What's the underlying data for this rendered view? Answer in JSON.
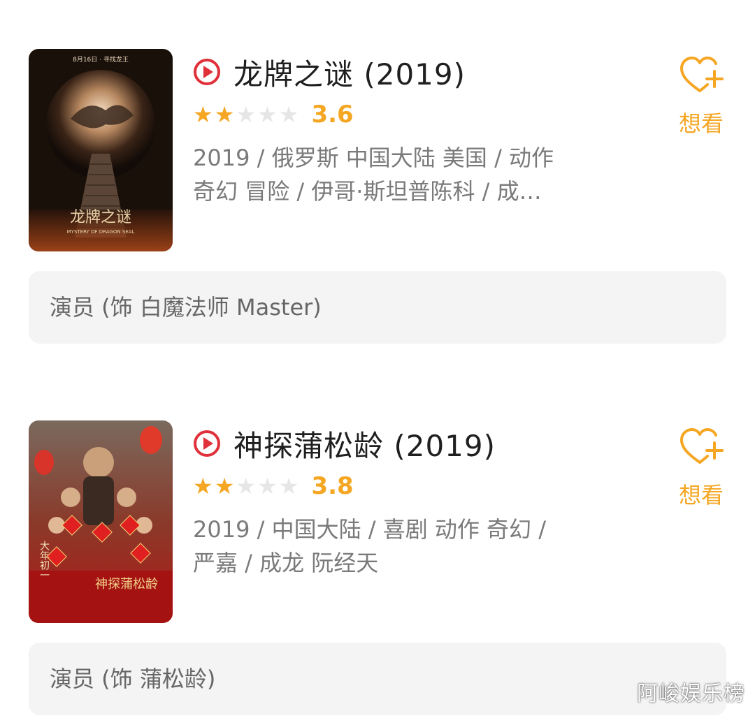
{
  "movies": [
    {
      "title": "龙牌之谜 (2019)",
      "stars_filled": 2,
      "stars_total": 5,
      "score": "3.6",
      "meta_line1": "2019 / 俄罗斯 中国大陆 美国 / 动作",
      "meta_line2": "奇幻 冒险 / 伊哥·斯坦普陈科 / 成…",
      "want_label": "想看",
      "role": "演员 (饰 白魔法师  Master)",
      "poster_date_text": "8月16日 · 寻找龙王",
      "poster_title_text": "龙牌之谜",
      "poster_en_text": "MYSTERY OF DRAGON SEAL"
    },
    {
      "title": "神探蒲松龄 (2019)",
      "stars_filled": 2,
      "stars_total": 5,
      "score": "3.8",
      "meta_line1": "2019 / 中国大陆 / 喜剧 动作 奇幻 /",
      "meta_line2": "严嘉 / 成龙 阮经天",
      "want_label": "想看",
      "role": "演员 (饰 蒲松龄)",
      "poster_side_text": "大年初一",
      "poster_title_text": "神探蒲松龄"
    }
  ],
  "watermark": "阿峻娱乐榜",
  "colors": {
    "accent": "#f5a623",
    "play_red": "#e0303a",
    "role_bg": "#f4f4f4"
  }
}
